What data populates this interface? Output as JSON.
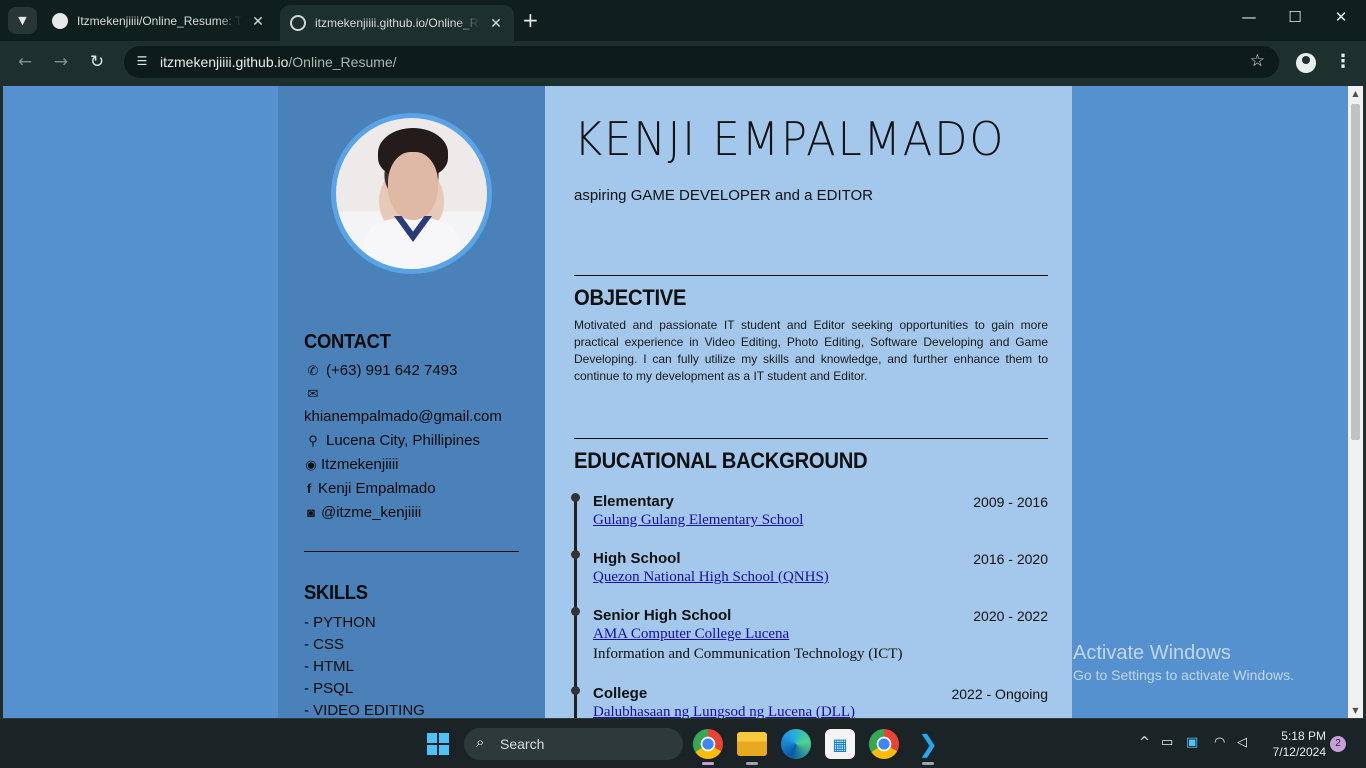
{
  "browser": {
    "tabs": [
      {
        "title": "Itzmekenjiiii/Online_Resume: Th",
        "active": false
      },
      {
        "title": "itzmekenjiiii.github.io/Online_Re",
        "active": true
      }
    ],
    "new_tab": "+",
    "url_host": "itzmekenjiiii.github.io",
    "url_path": "/Online_Resume/",
    "window_controls": {
      "minimize": "—",
      "maximize": "☐",
      "close": "✕"
    }
  },
  "resume": {
    "name": "KENJI EMPALMADO",
    "tagline": "aspiring GAME DEVELOPER and a EDITOR",
    "contact": {
      "heading": "CONTACT",
      "phone": "(+63) 991 642 7493",
      "email": "khianempalmado@gmail.com",
      "location": "Lucena City, Phillipines",
      "github": "Itzmekenjiiii",
      "facebook": "Kenji Empalmado",
      "instagram": "@itzme_kenjiiii"
    },
    "skills": {
      "heading": "SKILLS",
      "items": [
        "- PYTHON",
        "- CSS",
        "- HTML",
        "- PSQL",
        "- VIDEO EDITING"
      ]
    },
    "objective": {
      "heading": "OBJECTIVE",
      "text": "Motivated and passionate IT student and Editor seeking opportunities to gain more practical experience in Video Editing, Photo Editing, Software Developing and Game Developing. I can fully utilize my skills and knowledge, and further enhance them to continue to my development as a IT student and Editor."
    },
    "education": {
      "heading": "EDUCATIONAL BACKGROUND",
      "entries": [
        {
          "level": "Elementary",
          "years": "2009 - 2016",
          "school": "Gulang Gulang Elementary School",
          "extra": ""
        },
        {
          "level": "High School",
          "years": "2016 - 2020",
          "school": "Quezon National High School (QNHS)",
          "extra": ""
        },
        {
          "level": "Senior High School",
          "years": "2020 - 2022",
          "school": "AMA Computer College Lucena",
          "extra": "Information and Communication Technology (ICT)"
        },
        {
          "level": "College",
          "years": "2022 - Ongoing",
          "school": "Dalubhasaan ng Lungsod ng Lucena (DLL)",
          "extra": ""
        }
      ]
    }
  },
  "watermark": {
    "line1": "Activate Windows",
    "line2": "Go to Settings to activate Windows."
  },
  "taskbar": {
    "search_label": "Search",
    "time": "5:18 PM",
    "date": "7/12/2024",
    "notifications": "2"
  }
}
